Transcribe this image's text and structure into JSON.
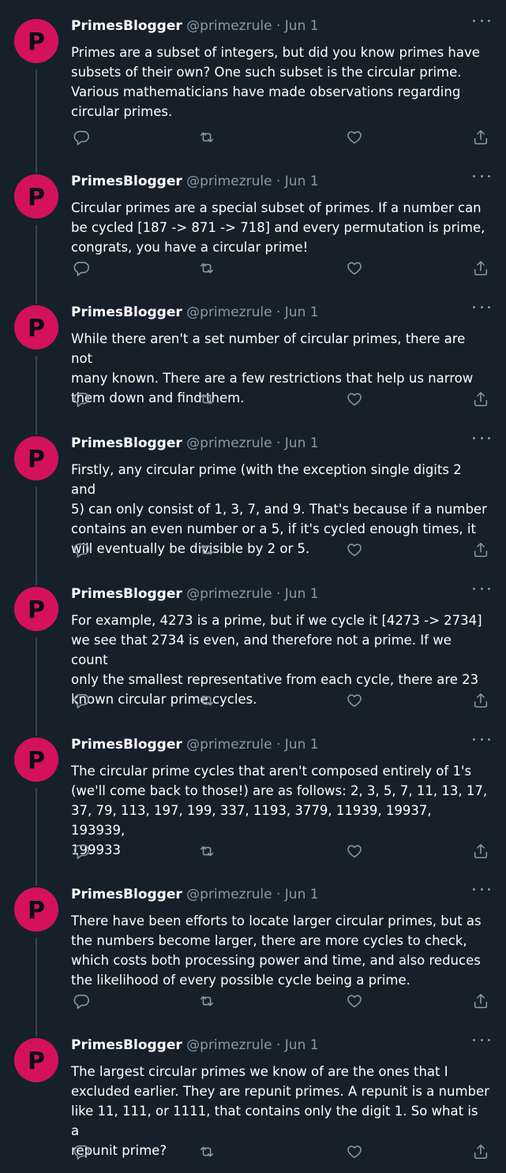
{
  "account": {
    "display_name": "PrimesBlogger",
    "handle": "@primezrule",
    "separator": "·",
    "date": "Jun 1",
    "avatar_letter": "P",
    "avatar_color": "#d3125b"
  },
  "theme": {
    "background": "#15202b",
    "text": "#ffffff",
    "muted": "#8899a6",
    "thread_line": "#38444d"
  },
  "actions": [
    "reply-icon",
    "retweet-icon",
    "like-icon",
    "share-icon"
  ],
  "tweets": [
    {
      "text": "Primes are a subset of integers, but did you know primes have\nsubsets of their own? One such subset is the circular prime.\nVarious mathematicians have made observations regarding\ncircular primes."
    },
    {
      "text": "Circular primes are a special subset of primes. If a number can\nbe cycled [187 -> 871 -> 718] and every permutation is prime,\ncongrats, you have a circular prime!"
    },
    {
      "text": "While there aren't a set number of circular primes, there are not\nmany known. There are a few restrictions that help us narrow\nthem down and find them."
    },
    {
      "text": "Firstly, any circular prime (with the exception single digits 2 and\n5) can only consist of 1, 3, 7, and 9. That's because if a number\ncontains an even number or a 5, if it's cycled enough times, it\nwill eventually be divisible by 2 or 5."
    },
    {
      "text": "For example, 4273 is a prime, but if we cycle it [4273 -> 2734]\nwe see that 2734 is even, and therefore not a prime. If we count\nonly the smallest representative from each cycle, there are 23\nknown circular prime cycles."
    },
    {
      "text": "The circular prime cycles that aren't composed entirely of 1's\n(we'll come back to those!) are as follows: 2, 3, 5, 7, 11, 13, 17,\n37, 79, 113, 197, 199, 337, 1193, 3779, 11939, 19937, 193939,\n199933"
    },
    {
      "text": "There have been efforts to locate larger circular primes, but as\nthe numbers become larger, there are more cycles to check,\nwhich costs both processing power and time, and also reduces\nthe likelihood of every possible cycle being a prime."
    },
    {
      "text": "The largest circular primes we know of are the ones that I\nexcluded earlier. They are repunit primes. A repunit is a number\nlike 11, 111, or 1111, that contains only the digit 1. So what is a\nrepunit prime?"
    }
  ]
}
